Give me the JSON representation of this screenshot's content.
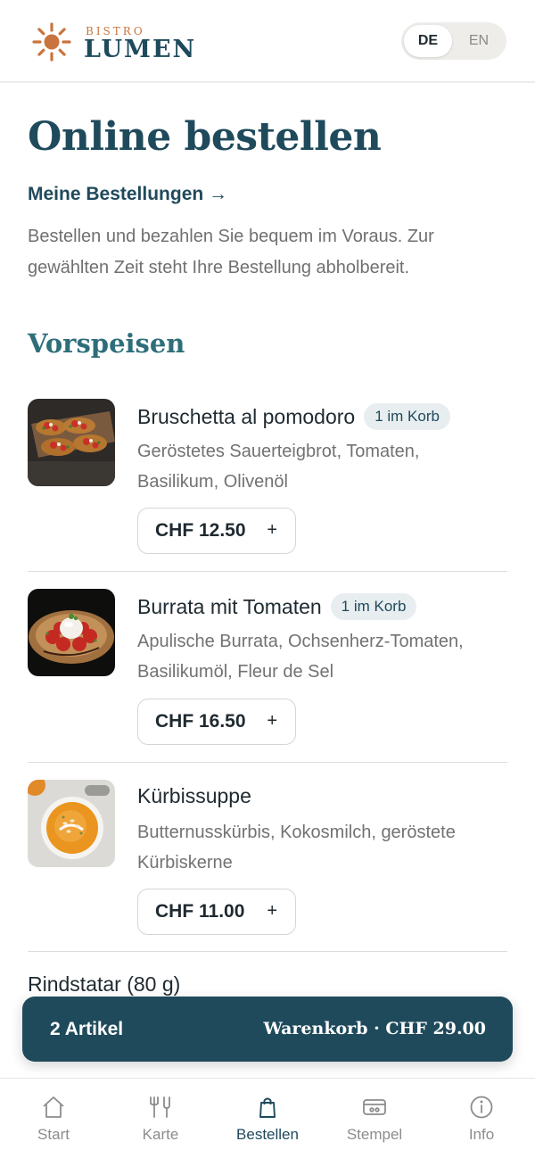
{
  "brand": {
    "small": "BISTRO",
    "name": "LUMEN",
    "accent": "#c9743e",
    "primary": "#1f4a5c"
  },
  "language": {
    "options": [
      "DE",
      "EN"
    ],
    "selected": "DE"
  },
  "page": {
    "title": "Online bestellen",
    "orders_link": "Meine Bestellungen →",
    "intro": "Bestellen und bezahlen Sie bequem im Voraus. Zur gewählten Zeit steht Ihre Bestellung abholbereit."
  },
  "section": {
    "title": "Vorspeisen"
  },
  "items": [
    {
      "name": "Bruschetta al pomodoro",
      "badge": "1 im Korb",
      "desc": "Geröstetes Sauerteigbrot, Tomaten, Basilikum, Olivenöl",
      "price": "CHF 12.50",
      "add": "+"
    },
    {
      "name": "Burrata mit Tomaten",
      "badge": "1 im Korb",
      "desc": "Apulische Burrata, Ochsenherz-Tomaten, Basilikumöl, Fleur de Sel",
      "price": "CHF 16.50",
      "add": "+"
    },
    {
      "name": "Kürbissuppe",
      "badge": "",
      "desc": "Butternusskürbis, Kokosmilch, geröstete Kürbiskerne",
      "price": "CHF 11.00",
      "add": "+"
    },
    {
      "name": "Rindstatar (80 g)"
    }
  ],
  "cart": {
    "count": "2 Artikel",
    "total": "Warenkorb · CHF 29.00"
  },
  "nav": [
    {
      "label": "Start",
      "icon": "home-icon"
    },
    {
      "label": "Karte",
      "icon": "cutlery-icon"
    },
    {
      "label": "Bestellen",
      "icon": "shopping-bag-icon",
      "active": true
    },
    {
      "label": "Stempel",
      "icon": "stamp-card-icon"
    },
    {
      "label": "Info",
      "icon": "info-icon"
    }
  ]
}
